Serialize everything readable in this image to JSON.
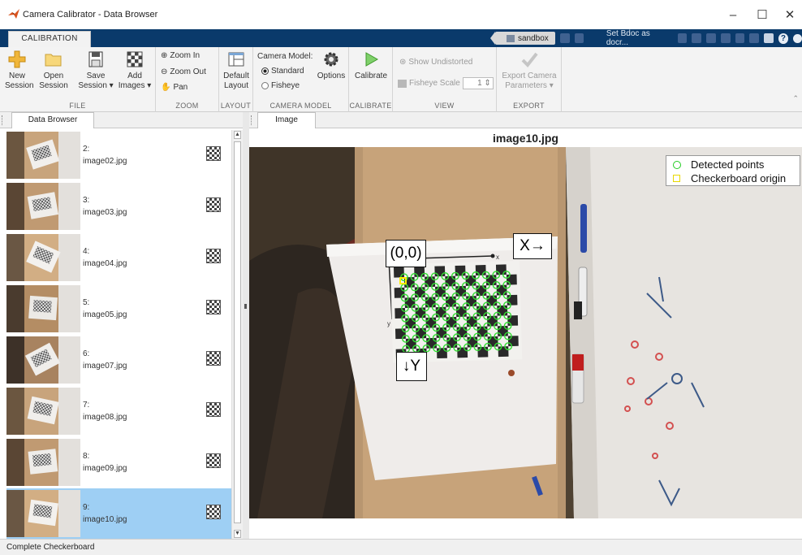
{
  "window": {
    "title": "Camera Calibrator - Data Browser",
    "minimize": "–",
    "maximize": "☐",
    "close": "✕"
  },
  "ribbon_tab": "CALIBRATION",
  "quick_access": {
    "sandbox_label": "sandbox",
    "set_doc_label": "Set Bdoc as docr..."
  },
  "ribbon": {
    "file": {
      "label": "FILE",
      "new_line1": "New",
      "new_line2": "Session",
      "open_line1": "Open",
      "open_line2": "Session",
      "save_line1": "Save",
      "save_line2": "Session ▾",
      "add_line1": "Add",
      "add_line2": "Images ▾"
    },
    "zoom": {
      "label": "ZOOM",
      "zoom_in": "Zoom In",
      "zoom_out": "Zoom Out",
      "pan": "Pan"
    },
    "layout": {
      "label": "LAYOUT",
      "default_line1": "Default",
      "default_line2": "Layout"
    },
    "camera_model": {
      "label": "CAMERA MODEL",
      "title": "Camera Model:",
      "standard": "Standard",
      "fisheye": "Fisheye",
      "options": "Options"
    },
    "calibrate": {
      "label": "CALIBRATE",
      "button": "Calibrate"
    },
    "view": {
      "label": "VIEW",
      "show_undistorted": "Show Undistorted",
      "fisheye_scale": "Fisheye Scale",
      "scale_value": "1"
    },
    "export": {
      "label": "EXPORT",
      "line1": "Export Camera",
      "line2": "Parameters ▾"
    }
  },
  "panels": {
    "data_browser_tab": "Data Browser",
    "image_tab": "Image"
  },
  "images": [
    {
      "index": "2:",
      "name": "image02.jpg",
      "selected": false
    },
    {
      "index": "3:",
      "name": "image03.jpg",
      "selected": false
    },
    {
      "index": "4:",
      "name": "image04.jpg",
      "selected": false
    },
    {
      "index": "5:",
      "name": "image05.jpg",
      "selected": false
    },
    {
      "index": "6:",
      "name": "image07.jpg",
      "selected": false
    },
    {
      "index": "7:",
      "name": "image08.jpg",
      "selected": false
    },
    {
      "index": "8:",
      "name": "image09.jpg",
      "selected": false
    },
    {
      "index": "9:",
      "name": "image10.jpg",
      "selected": true
    }
  ],
  "viewer": {
    "image_title": "image10.jpg",
    "legend_detected": "Detected points",
    "legend_origin": "Checkerboard origin",
    "origin_label": "(0,0)",
    "x_label": "X→",
    "y_label": "↓Y",
    "axis_x_letter": "x",
    "axis_y_letter": "y"
  },
  "status": "Complete Checkerboard",
  "colors": {
    "tabstrip": "#0a3a6b",
    "selected_row": "#9ecff4",
    "detected_points": "#33dd33",
    "origin_marker": "#ffee00"
  }
}
